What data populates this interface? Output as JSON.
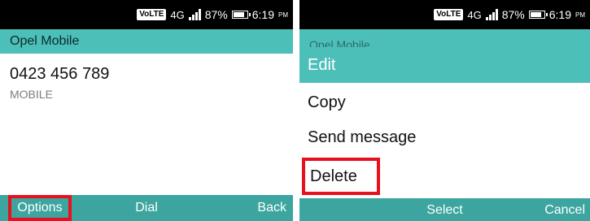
{
  "status_bar": {
    "volte": "VoLTE",
    "network": "4G",
    "battery": "87%",
    "time": "6:19",
    "time_suffix": "PM"
  },
  "left": {
    "title": "Opel Mobile",
    "number": "0423 456 789",
    "type": "MOBILE",
    "softkeys": {
      "left": "Options",
      "center": "Dial",
      "right": "Back"
    }
  },
  "right": {
    "underlay_title": "Opel Mobile",
    "menu_title": "Edit",
    "items": [
      "Copy",
      "Send message",
      "Delete"
    ],
    "softkeys": {
      "center": "Select",
      "right": "Cancel"
    }
  },
  "colors": {
    "teal_header": "#4cbfb9",
    "teal_softkeys": "#3da59f",
    "highlight": "#e8101d"
  }
}
